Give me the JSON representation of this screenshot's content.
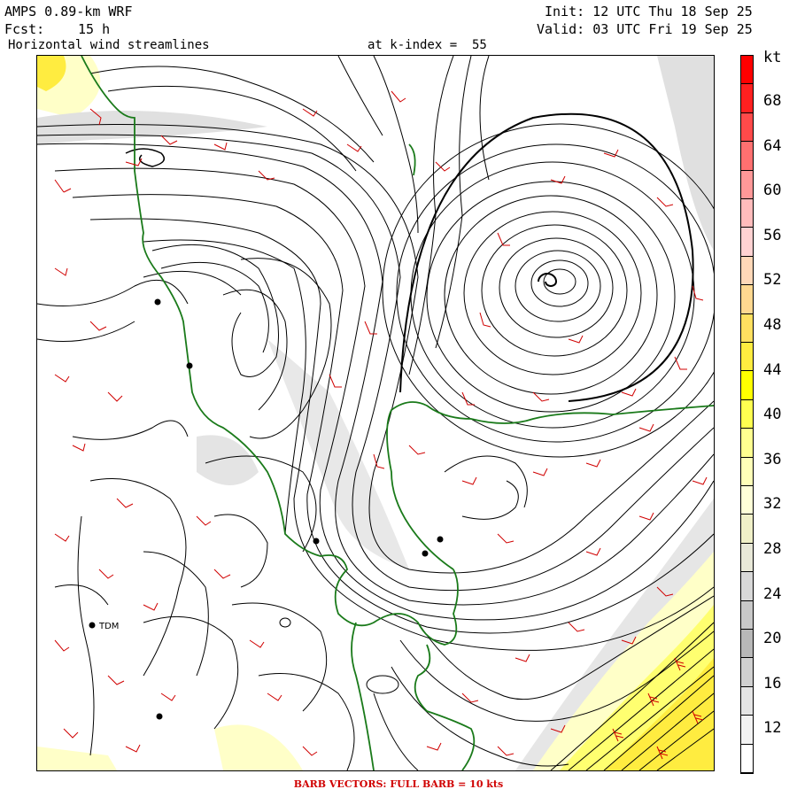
{
  "header": {
    "model": "AMPS 0.89-km WRF",
    "init": "Init: 12 UTC Thu 18 Sep 25",
    "fcst_label": "Fcst:",
    "fcst_value": "15 h",
    "valid": "Valid: 03 UTC Fri 19 Sep 25",
    "field": "Horizontal wind streamlines",
    "level": "at k-index =  55"
  },
  "colorbar": {
    "unit": "kt",
    "labels": [
      "68",
      "64",
      "60",
      "56",
      "52",
      "48",
      "44",
      "40",
      "36",
      "32",
      "28",
      "24",
      "20",
      "16",
      "12"
    ],
    "colors": [
      "#ff0000",
      "#ff2020",
      "#ff4a4a",
      "#ff7070",
      "#ff9898",
      "#ffbcbc",
      "#ffd2d2",
      "#ffd8b8",
      "#ffd890",
      "#ffe060",
      "#ffec40",
      "#ffff00",
      "#ffff50",
      "#ffff90",
      "#ffffb8",
      "#ffffd8",
      "#f0f0c8",
      "#e8e8d8",
      "#d8d8d8",
      "#c8c8c8",
      "#b8b8b8",
      "#d0d0d0",
      "#e4e4e4",
      "#f2f2f2",
      "#ffffff"
    ]
  },
  "stations": [
    {
      "label": "TDM"
    }
  ],
  "footer": "BARB VECTORS:  FULL BARB = 10 kts"
}
